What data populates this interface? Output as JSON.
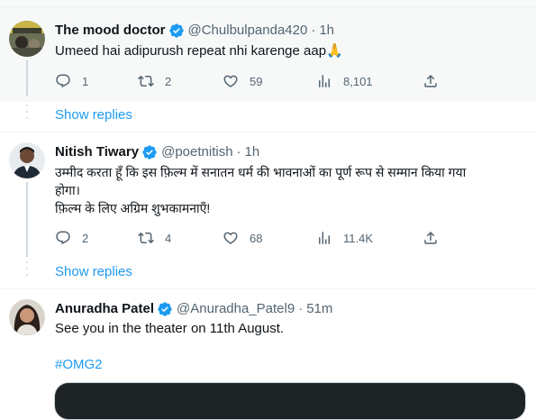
{
  "tweets": [
    {
      "name": "The mood doctor",
      "handle": "@Chulbulpanda420",
      "time": "1h",
      "text_lines": [
        "Umeed hai adipurush repeat nhi karenge aap🙏"
      ],
      "stats": {
        "replies": "1",
        "retweets": "2",
        "likes": "59",
        "views": "8,101"
      },
      "show_replies": "Show replies"
    },
    {
      "name": "Nitish Tiwary",
      "handle": "@poetnitish",
      "time": "1h",
      "text_lines": [
        "उम्मीद करता हूँ कि इस फ़िल्म में सनातन धर्म की भावनाओं का पूर्ण रूप से सम्मान किया गया",
        "होगा।",
        "फ़िल्म के लिए अग्रिम शुभकामनाएँ!"
      ],
      "stats": {
        "replies": "2",
        "retweets": "4",
        "likes": "68",
        "views": "11.4K"
      },
      "show_replies": "Show replies"
    },
    {
      "name": "Anuradha Patel",
      "handle": "@Anuradha_Patel9",
      "time": "51m",
      "text_lines": [
        "See you in the theater on 11th August."
      ],
      "hashtag": "#OMG2"
    }
  ],
  "separator": "·",
  "icons": {
    "verified": "verified-badge-icon",
    "reply": "reply-icon",
    "retweet": "retweet-icon",
    "like": "heart-icon",
    "views": "views-icon",
    "share": "share-icon"
  },
  "colors": {
    "accent": "#1d9bf0",
    "secondary_text": "#536471",
    "divider": "#eff3f4"
  }
}
